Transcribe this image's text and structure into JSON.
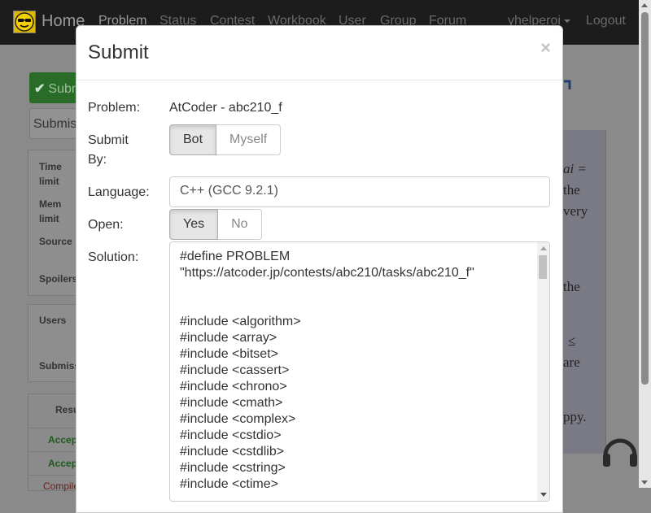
{
  "navbar": {
    "home": "Home",
    "links": [
      "Problem",
      "Status",
      "Contest",
      "Workbook",
      "User",
      "Group",
      "Forum"
    ],
    "user": "yhelperoi",
    "logout": "Logout"
  },
  "background": {
    "submit_button": "Submit",
    "submissions_input": "Submissions",
    "info_labels": [
      "Time limit",
      "Mem limit",
      "Source",
      "Spoilers"
    ],
    "users_labels": [
      "Users",
      "Submissions"
    ],
    "results_header": "Result",
    "results": [
      "Accepted",
      "Accepted",
      "Compile"
    ],
    "right_text": [
      "ai =",
      "the",
      "very",
      "the",
      "≤",
      "are",
      "ppy."
    ]
  },
  "modal": {
    "title": "Submit",
    "close": "×",
    "problem_label": "Problem:",
    "problem_value": "AtCoder - abc210_f",
    "submit_by_label": "Submit By:",
    "submit_by_options": [
      "Bot",
      "Myself"
    ],
    "submit_by_selected": "Bot",
    "language_label": "Language:",
    "language_value": "C++ (GCC 9.2.1)",
    "open_label": "Open:",
    "open_options": [
      "Yes",
      "No"
    ],
    "open_selected": "Yes",
    "solution_label": "Solution:",
    "solution_lines": [
      "#define PROBLEM",
      "\"https://atcoder.jp/contests/abc210/tasks/abc210_f\"",
      "",
      "",
      "#include <algorithm>",
      "#include <array>",
      "#include <bitset>",
      "#include <cassert>",
      "#include <chrono>",
      "#include <cmath>",
      "#include <complex>",
      "#include <cstdio>",
      "#include <cstdlib>",
      "#include <cstring>",
      "#include <ctime>"
    ]
  },
  "colors": {
    "navbar": "#1c1c1c",
    "overlay_page": "#8a8a8a",
    "success": "#286c28",
    "active_button": "#e6e6e6"
  }
}
